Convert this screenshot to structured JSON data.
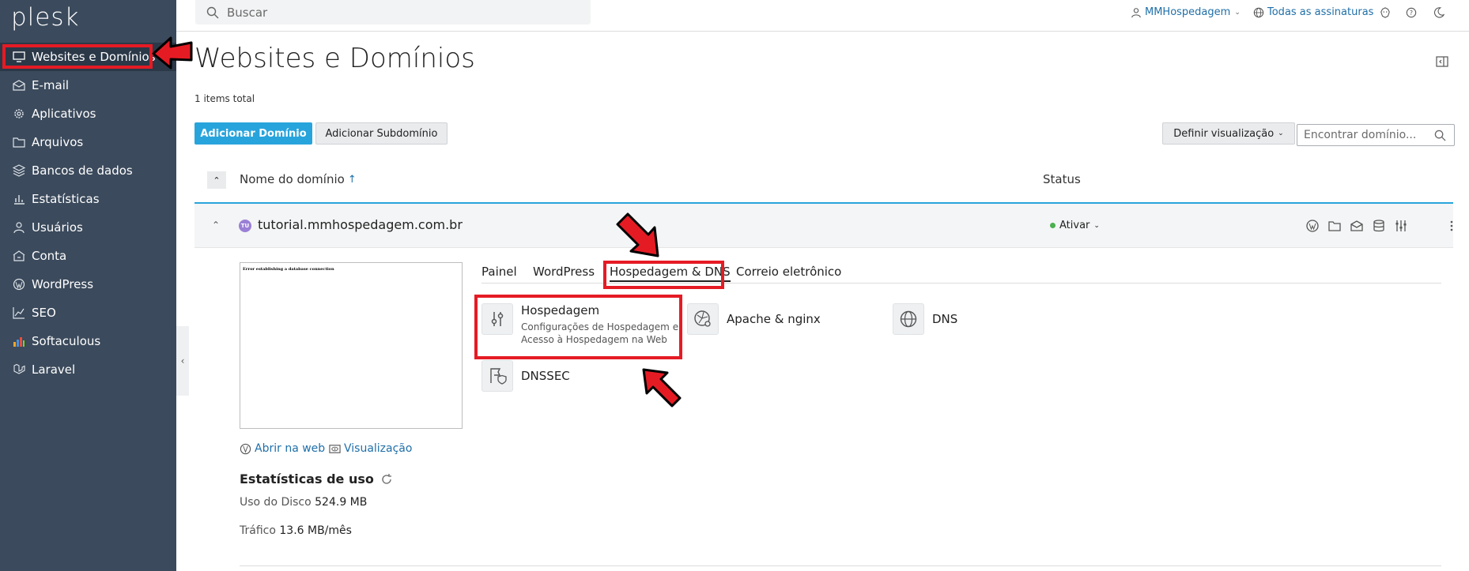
{
  "sidebar": {
    "logo": "plesk",
    "items": [
      {
        "label": "Websites e Domínios",
        "icon": "monitor-icon"
      },
      {
        "label": "E-mail",
        "icon": "mail-icon"
      },
      {
        "label": "Aplicativos",
        "icon": "gear-icon"
      },
      {
        "label": "Arquivos",
        "icon": "folder-icon"
      },
      {
        "label": "Bancos de dados",
        "icon": "database-icon"
      },
      {
        "label": "Estatísticas",
        "icon": "bar-chart-icon"
      },
      {
        "label": "Usuários",
        "icon": "user-icon"
      },
      {
        "label": "Conta",
        "icon": "account-icon"
      },
      {
        "label": "WordPress",
        "icon": "wordpress-icon"
      },
      {
        "label": "SEO",
        "icon": "seo-icon"
      },
      {
        "label": "Softaculous",
        "icon": "softaculous-icon"
      },
      {
        "label": "Laravel",
        "icon": "laravel-icon"
      }
    ]
  },
  "topbar": {
    "search_placeholder": "Buscar",
    "user": "MMHospedagem",
    "subscriptions": "Todas as assinaturas"
  },
  "main": {
    "title": "Websites e Domínios",
    "items_total": "1 items total",
    "add_domain": "Adicionar Domínio",
    "add_subdomain": "Adicionar Subdomínio",
    "define_view": "Definir visualização",
    "find_placeholder": "Encontrar domínio...",
    "col_domain": "Nome do domínio",
    "col_domain_sort": "↑",
    "col_status": "Status"
  },
  "domain": {
    "badge": "TU",
    "name": "tutorial.mmhospedagem.com.br",
    "status": "Ativar",
    "preview_error": "Error establishing a database connection",
    "open_web": "Abrir na web",
    "preview": "Visualização",
    "stats_title": "Estatísticas de uso",
    "disk_label": "Uso do Disco",
    "disk_value": "524.9 MB",
    "traffic_label": "Tráfico",
    "traffic_value": "13.6 MB/mês"
  },
  "tabs": [
    "Painel",
    "WordPress",
    "Hospedagem & DNS",
    "Correio eletrônico"
  ],
  "tiles": [
    {
      "title": "Hospedagem",
      "desc1": "Configurações de Hospedagem e",
      "desc2": "Acesso à Hospedagem na Web"
    },
    {
      "title": "Apache & nginx"
    },
    {
      "title": "DNS"
    },
    {
      "title": "DNSSEC"
    }
  ],
  "colors": {
    "sidebar": "#3b4a5c",
    "primary": "#28a4dc",
    "link": "#1f6fa8",
    "annotation": "#e51b24"
  }
}
